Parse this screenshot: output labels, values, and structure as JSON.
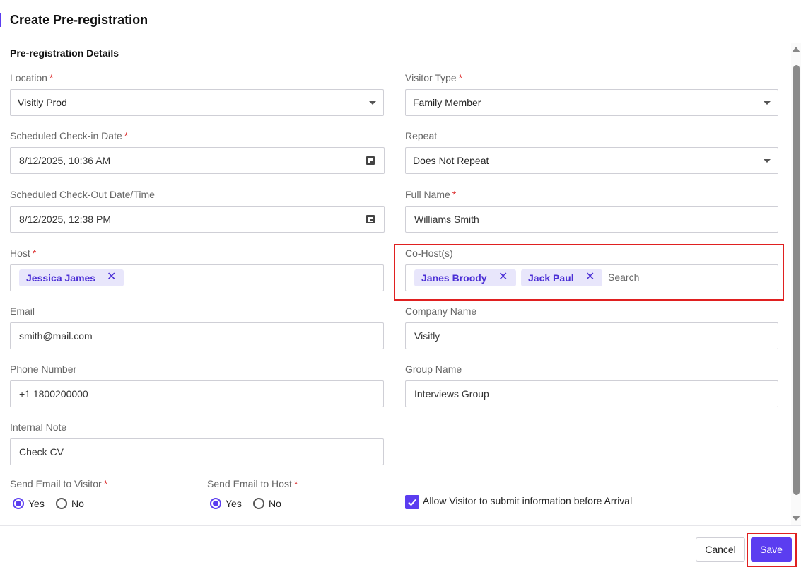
{
  "header": {
    "title": "Create Pre-registration"
  },
  "section": {
    "title": "Pre-registration Details"
  },
  "fields": {
    "location": {
      "label": "Location",
      "required": "*",
      "value": "Visitly Prod"
    },
    "visitor_type": {
      "label": "Visitor Type",
      "required": "*",
      "value": "Family Member"
    },
    "checkin_date": {
      "label": "Scheduled Check-in Date",
      "required": "*",
      "value": "8/12/2025, 10:36 AM"
    },
    "repeat": {
      "label": "Repeat",
      "value": "Does Not Repeat"
    },
    "checkout_date": {
      "label": "Scheduled Check-Out Date/Time",
      "value": "8/12/2025, 12:38 PM"
    },
    "full_name": {
      "label": "Full Name",
      "required": "*",
      "value": "Williams Smith"
    },
    "host": {
      "label": "Host",
      "required": "*",
      "chips": [
        "Jessica James"
      ]
    },
    "co_hosts": {
      "label": "Co-Host(s)",
      "chips": [
        "Janes Broody",
        "Jack Paul"
      ],
      "placeholder": "Search"
    },
    "email": {
      "label": "Email",
      "value": "smith@mail.com"
    },
    "company_name": {
      "label": "Company Name",
      "value": "Visitly"
    },
    "phone": {
      "label": "Phone Number",
      "value": "+1 1800200000"
    },
    "group_name": {
      "label": "Group Name",
      "value": "Interviews Group"
    },
    "internal_note": {
      "label": "Internal Note",
      "value": "Check CV"
    }
  },
  "send_email_visitor": {
    "label": "Send Email to Visitor",
    "required": "*",
    "yes": "Yes",
    "no": "No",
    "selected": "Yes"
  },
  "send_email_host": {
    "label": "Send Email to Host",
    "required": "*",
    "yes": "Yes",
    "no": "No",
    "selected": "Yes"
  },
  "allow_visitor": {
    "label": "Allow Visitor to submit information before Arrival",
    "checked": true
  },
  "footer": {
    "cancel_label": "Cancel",
    "save_label": "Save"
  },
  "colors": {
    "accent": "#5b3df0",
    "chip_bg": "#e8e6fb",
    "highlight": "#e02020",
    "required": "#d33"
  },
  "icons": {
    "select": "chevron-down-icon",
    "date": "calendar-icon",
    "remove_chip": "close-icon",
    "check": "check-icon"
  }
}
